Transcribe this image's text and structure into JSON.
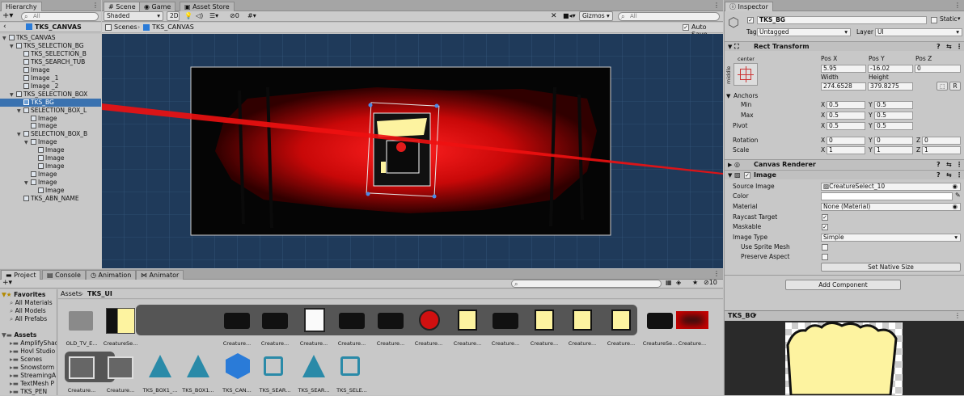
{
  "hierarchy": {
    "tab": "Hierarchy",
    "search_placeholder": "All",
    "root": "TKS_CANVAS",
    "items": [
      {
        "label": "TKS_CANVAS",
        "indent": 0,
        "arrow": "▼",
        "selected": false
      },
      {
        "label": "TKS_SELECTION_BG",
        "indent": 1,
        "arrow": "▼",
        "selected": false
      },
      {
        "label": "TKS_SELECTION_B",
        "indent": 2,
        "arrow": "",
        "selected": false
      },
      {
        "label": "TKS_SEARCH_TUB",
        "indent": 2,
        "arrow": "",
        "selected": false
      },
      {
        "label": "Image",
        "indent": 2,
        "arrow": "",
        "selected": false
      },
      {
        "label": "Image _1",
        "indent": 2,
        "arrow": "",
        "selected": false
      },
      {
        "label": "Image _2",
        "indent": 2,
        "arrow": "",
        "selected": false
      },
      {
        "label": "TKS_SELECTION_BOX",
        "indent": 1,
        "arrow": "▼",
        "selected": false
      },
      {
        "label": "TKS_BG",
        "indent": 2,
        "arrow": "",
        "selected": true
      },
      {
        "label": "SELECTION_BOX_L",
        "indent": 2,
        "arrow": "▼",
        "selected": false
      },
      {
        "label": "Image",
        "indent": 3,
        "arrow": "",
        "selected": false
      },
      {
        "label": "Image",
        "indent": 3,
        "arrow": "",
        "selected": false
      },
      {
        "label": "SELECTION_BOX_B",
        "indent": 2,
        "arrow": "▼",
        "selected": false
      },
      {
        "label": "Image",
        "indent": 3,
        "arrow": "▼",
        "selected": false
      },
      {
        "label": "Image",
        "indent": 4,
        "arrow": "",
        "selected": false
      },
      {
        "label": "Image",
        "indent": 4,
        "arrow": "",
        "selected": false
      },
      {
        "label": "Image",
        "indent": 4,
        "arrow": "",
        "selected": false
      },
      {
        "label": "Image",
        "indent": 3,
        "arrow": "",
        "selected": false
      },
      {
        "label": "Image",
        "indent": 3,
        "arrow": "▼",
        "selected": false
      },
      {
        "label": "Image",
        "indent": 4,
        "arrow": "",
        "selected": false
      },
      {
        "label": "TKS_ABN_NAME",
        "indent": 2,
        "arrow": "",
        "selected": false
      }
    ]
  },
  "scene": {
    "tabs": [
      "Scene",
      "Game",
      "Asset Store"
    ],
    "shading": "Shaded",
    "mode_2d": "2D",
    "hidden_count": "0",
    "gizmos": "Gizmos",
    "search_placeholder": "All",
    "breadcrumb_root": "Scenes",
    "breadcrumb_current": "TKS_CANVAS",
    "auto_save": "Auto Save"
  },
  "project": {
    "tabs": [
      "Project",
      "Console",
      "Animation",
      "Animator"
    ],
    "breadcrumb": [
      "Assets",
      "TKS_UI"
    ],
    "hidden_count": "10",
    "tree": [
      {
        "label": "Favorites",
        "indent": 0,
        "bold": true
      },
      {
        "label": "All Materials",
        "indent": 1,
        "bold": false
      },
      {
        "label": "All Models",
        "indent": 1,
        "bold": false
      },
      {
        "label": "All Prefabs",
        "indent": 1,
        "bold": false
      },
      {
        "label": "",
        "indent": 0,
        "bold": false
      },
      {
        "label": "Assets",
        "indent": 0,
        "bold": true
      },
      {
        "label": "AmplifyShad",
        "indent": 1,
        "bold": false
      },
      {
        "label": "Hovl Studio",
        "indent": 1,
        "bold": false
      },
      {
        "label": "Scenes",
        "indent": 1,
        "bold": false
      },
      {
        "label": "Snowstorm",
        "indent": 1,
        "bold": false
      },
      {
        "label": "StreamingA",
        "indent": 1,
        "bold": false
      },
      {
        "label": "TextMesh P",
        "indent": 1,
        "bold": false
      },
      {
        "label": "TKS_PEN",
        "indent": 1,
        "bold": false
      }
    ],
    "assets_row1": [
      "OLD_TV_E...",
      "CreatureSe...",
      "Creature...",
      "Creature...",
      "Creature...",
      "Creature...",
      "Creature...",
      "Creature...",
      "Creature...",
      "Creature...",
      "Creature...",
      "Creature...",
      "Creature...",
      "CreatureSe...",
      "Creature..."
    ],
    "assets_row2": [
      "Creature...",
      "Creature...",
      "TKS_BOX1_...",
      "TKS_BOX1...",
      "TKS_CAN...",
      "TKS_SEAR...",
      "TKS_SEAR...",
      "TKS_SELE..."
    ]
  },
  "inspector": {
    "tab": "Inspector",
    "object_name": "TKS_BG",
    "static_label": "Static",
    "tag_label": "Tag",
    "tag_value": "Untagged",
    "layer_label": "Layer",
    "layer_value": "UI",
    "rect_transform": {
      "title": "Rect Transform",
      "anchor_h": "center",
      "anchor_v": "middle",
      "pos_x_label": "Pos X",
      "pos_x": "5.95",
      "pos_y_label": "Pos Y",
      "pos_y": "-16.02",
      "pos_z_label": "Pos Z",
      "pos_z": "0",
      "width_label": "Width",
      "width": "274.6528",
      "height_label": "Height",
      "height": "379.8275",
      "r_button": "R",
      "anchors_label": "Anchors",
      "min_label": "Min",
      "min_x": "0.5",
      "min_y": "0.5",
      "max_label": "Max",
      "max_x": "0.5",
      "max_y": "0.5",
      "pivot_label": "Pivot",
      "pivot_x": "0.5",
      "pivot_y": "0.5",
      "rotation_label": "Rotation",
      "rot_x": "0",
      "rot_y": "0",
      "rot_z": "0",
      "scale_label": "Scale",
      "scale_x": "1",
      "scale_y": "1",
      "scale_z": "1",
      "x": "X",
      "y": "Y",
      "z": "Z"
    },
    "canvas_renderer": "Canvas Renderer",
    "image": {
      "title": "Image",
      "source_image_label": "Source Image",
      "source_image": "CreatureSelect_10",
      "color_label": "Color",
      "material_label": "Material",
      "material": "None (Material)",
      "raycast_label": "Raycast Target",
      "maskable_label": "Maskable",
      "image_type_label": "Image Type",
      "image_type": "Simple",
      "sprite_mesh_label": "Use Sprite Mesh",
      "preserve_label": "Preserve Aspect",
      "native_size": "Set Native Size"
    },
    "add_component": "Add Component",
    "preview_title": "TKS_BG"
  },
  "colors": {
    "selection": "#3a72b0",
    "scene_bg": "#1f3a5a",
    "accent_red": "#e01010",
    "cream": "#fdf3a0"
  }
}
